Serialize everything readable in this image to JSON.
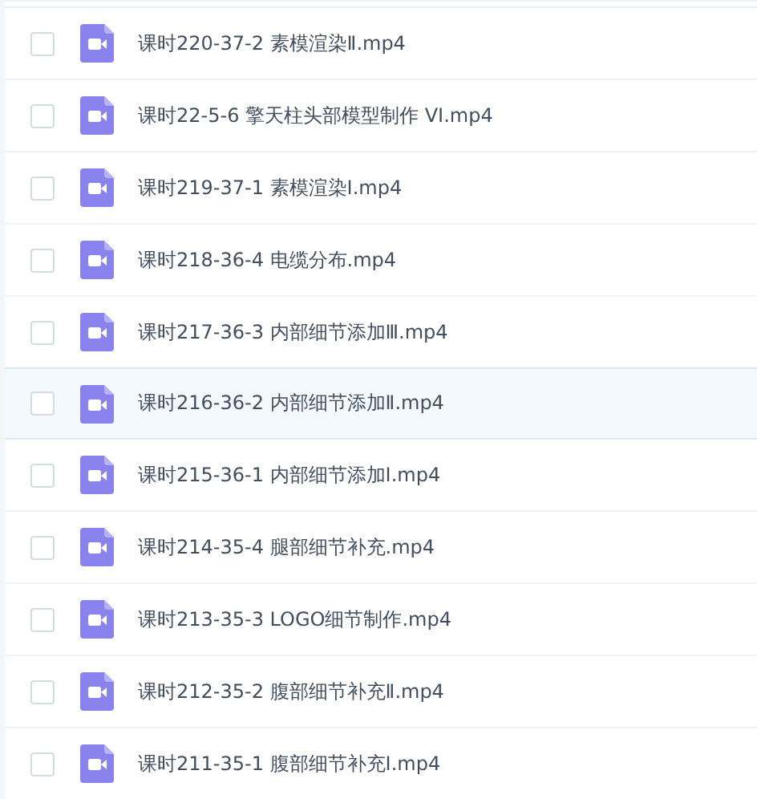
{
  "files": [
    {
      "name": "课时220-37-2 素模渲染Ⅱ.mp4",
      "selected": false,
      "checked": false
    },
    {
      "name": "课时22-5-6 擎天柱头部模型制作 VI.mp4",
      "selected": false,
      "checked": false
    },
    {
      "name": "课时219-37-1 素模渲染Ⅰ.mp4",
      "selected": false,
      "checked": false
    },
    {
      "name": "课时218-36-4 电缆分布.mp4",
      "selected": false,
      "checked": false
    },
    {
      "name": "课时217-36-3 内部细节添加Ⅲ.mp4",
      "selected": false,
      "checked": false
    },
    {
      "name": "课时216-36-2 内部细节添加Ⅱ.mp4",
      "selected": true,
      "checked": false
    },
    {
      "name": "课时215-36-1 内部细节添加Ⅰ.mp4",
      "selected": false,
      "checked": false
    },
    {
      "name": "课时214-35-4 腿部细节补充.mp4",
      "selected": false,
      "checked": false
    },
    {
      "name": "课时213-35-3 LOGO细节制作.mp4",
      "selected": false,
      "checked": false
    },
    {
      "name": "课时212-35-2 腹部细节补充Ⅱ.mp4",
      "selected": false,
      "checked": false
    },
    {
      "name": "课时211-35-1 腹部细节补充Ⅰ.mp4",
      "selected": false,
      "checked": false
    }
  ]
}
